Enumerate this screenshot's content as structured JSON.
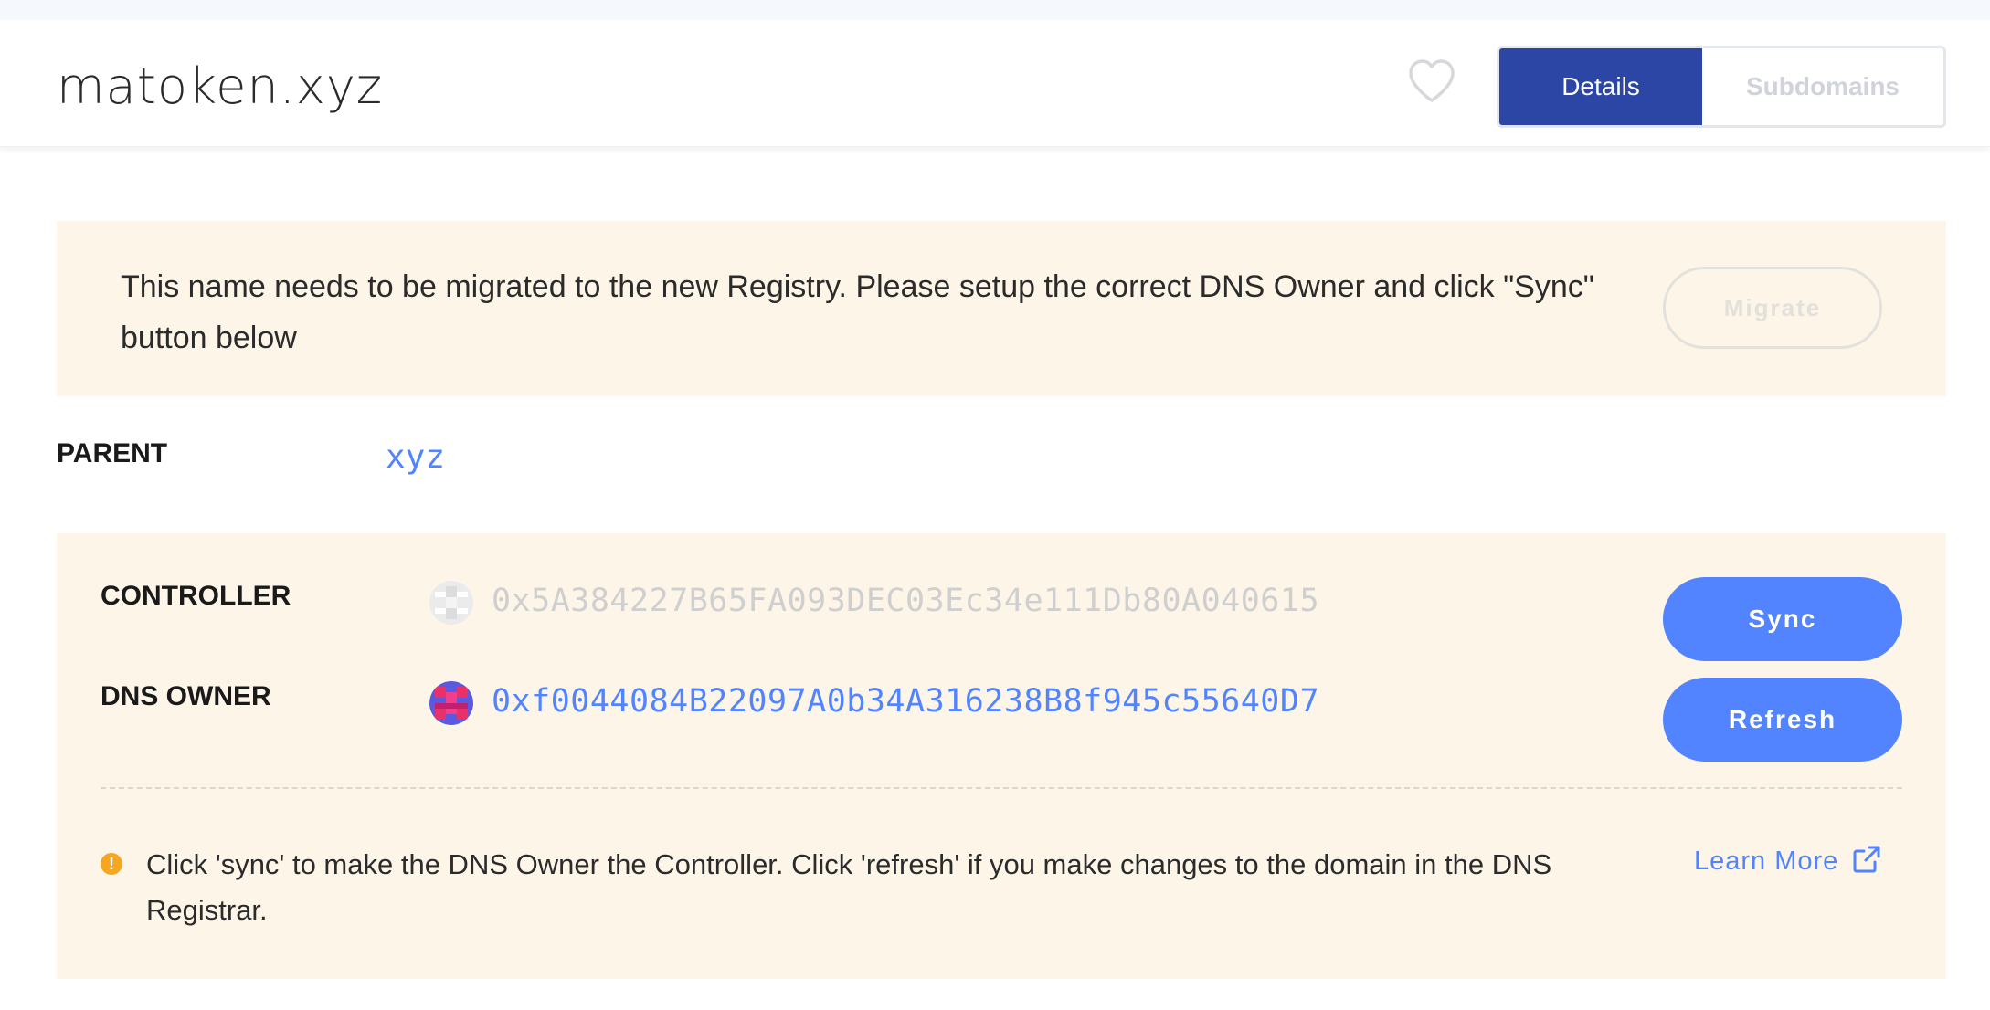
{
  "header": {
    "domain_name": "matoken.xyz",
    "tabs": [
      {
        "label": "Details",
        "active": true
      },
      {
        "label": "Subdomains",
        "active": false
      }
    ],
    "favorite_icon": "heart-outline-icon"
  },
  "notice": {
    "message": "This name needs to be migrated to the new Registry. Please setup the correct DNS Owner and click \"Sync\" button below",
    "migrate_label": "Migrate"
  },
  "parent": {
    "label": "PARENT",
    "value": "xyz"
  },
  "dns": {
    "controller_label": "CONTROLLER",
    "controller_address": "0x5A384227B65FA093DEC03Ec34e111Db80A040615",
    "owner_label": "DNS OWNER",
    "owner_address": "0xf0044084B22097A0b34A316238B8f945c55640D7",
    "sync_label": "Sync",
    "refresh_label": "Refresh",
    "hint": "Click 'sync' to make the DNS Owner the Controller. Click 'refresh' if you make changes to the domain in the DNS Registrar.",
    "learn_more_label": "Learn More",
    "warning_icon": "warning-icon",
    "external_link_icon": "external-link-icon"
  },
  "colors": {
    "accent_blue": "#5284ff",
    "active_tab": "#2c46a6",
    "panel_bg": "#fdf5e8",
    "warning": "#f5a623"
  }
}
